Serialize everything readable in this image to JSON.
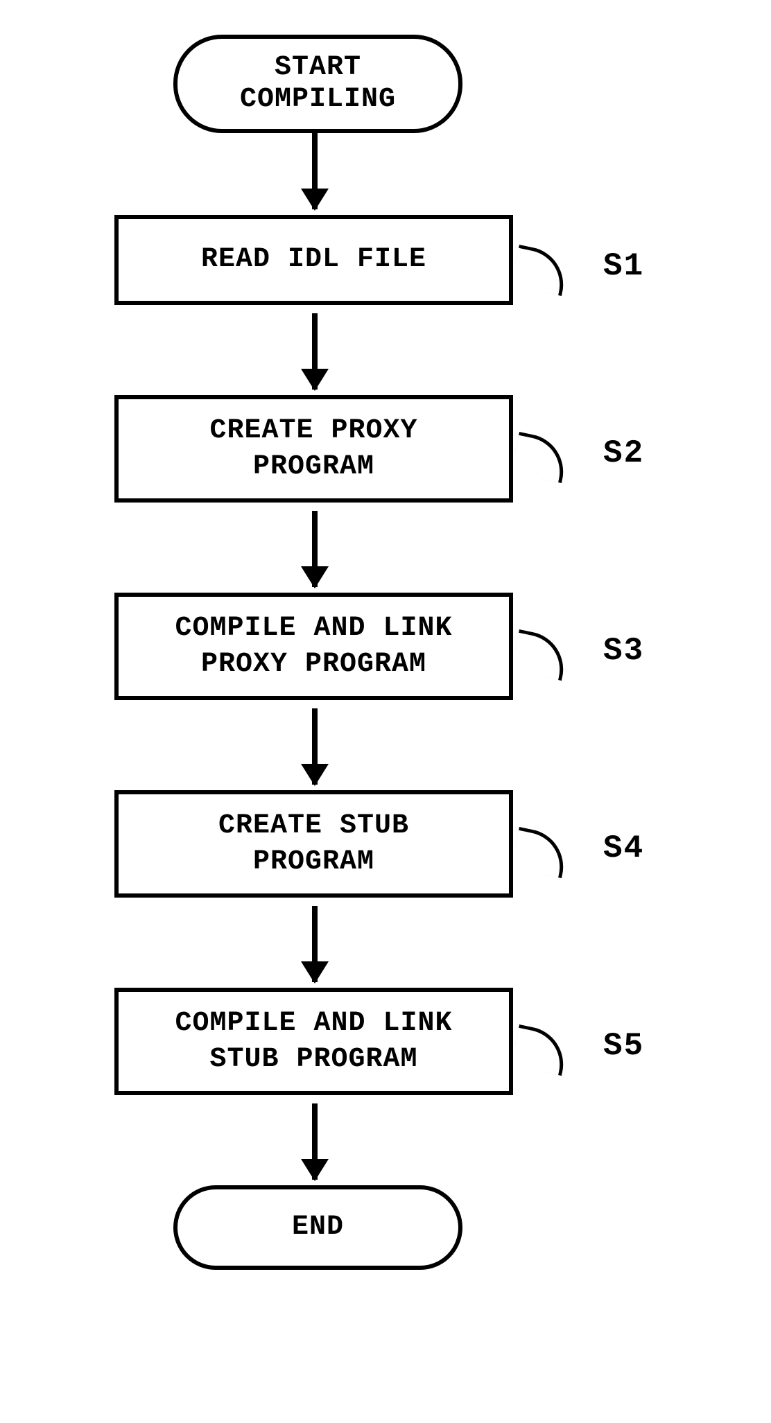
{
  "chart_data": {
    "type": "flowchart",
    "nodes": [
      {
        "id": "start",
        "type": "terminator",
        "label": "START\nCOMPILING"
      },
      {
        "id": "s1",
        "type": "process",
        "label": "READ IDL FILE",
        "step": "S1"
      },
      {
        "id": "s2",
        "type": "process",
        "label": "CREATE PROXY\nPROGRAM",
        "step": "S2"
      },
      {
        "id": "s3",
        "type": "process",
        "label": "COMPILE AND LINK\nPROXY PROGRAM",
        "step": "S3"
      },
      {
        "id": "s4",
        "type": "process",
        "label": "CREATE STUB\nPROGRAM",
        "step": "S4"
      },
      {
        "id": "s5",
        "type": "process",
        "label": "COMPILE AND LINK\nSTUB PROGRAM",
        "step": "S5"
      },
      {
        "id": "end",
        "type": "terminator",
        "label": "END"
      }
    ],
    "edges": [
      {
        "from": "start",
        "to": "s1"
      },
      {
        "from": "s1",
        "to": "s2"
      },
      {
        "from": "s2",
        "to": "s3"
      },
      {
        "from": "s3",
        "to": "s4"
      },
      {
        "from": "s4",
        "to": "s5"
      },
      {
        "from": "s5",
        "to": "end"
      }
    ]
  },
  "labels": {
    "start_line1": "START",
    "start_line2": "COMPILING",
    "s1_text": "READ IDL FILE",
    "s1_step": "S1",
    "s2_line1": "CREATE PROXY",
    "s2_line2": "PROGRAM",
    "s2_step": "S2",
    "s3_line1": "COMPILE AND LINK",
    "s3_line2": "PROXY PROGRAM",
    "s3_step": "S3",
    "s4_line1": "CREATE STUB",
    "s4_line2": "PROGRAM",
    "s4_step": "S4",
    "s5_line1": "COMPILE AND LINK",
    "s5_line2": "STUB PROGRAM",
    "s5_step": "S5",
    "end_text": "END"
  }
}
